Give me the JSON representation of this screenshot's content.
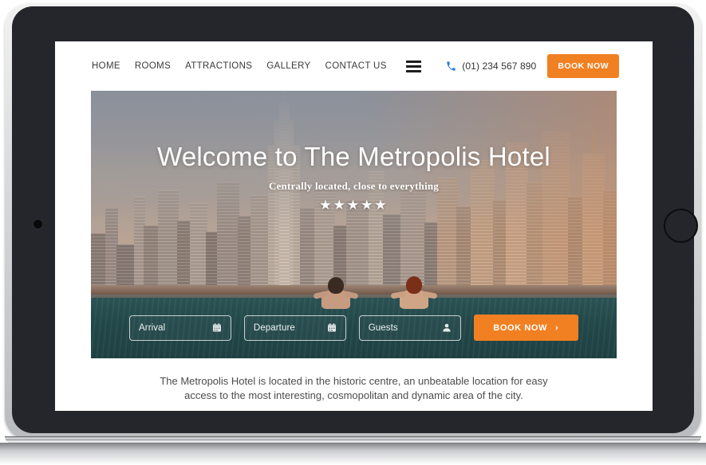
{
  "device": {
    "type": "tablet-landscape",
    "frame_color": "#24262b",
    "bezel_color": "#d6d7d9"
  },
  "header": {
    "nav": [
      {
        "label": "HOME",
        "name": "nav-home"
      },
      {
        "label": "ROOMS",
        "name": "nav-rooms"
      },
      {
        "label": "ATTRACTIONS",
        "name": "nav-attractions"
      },
      {
        "label": "GALLERY",
        "name": "nav-gallery"
      },
      {
        "label": "CONTACT US",
        "name": "nav-contact-us"
      }
    ],
    "menu_icon": "hamburger-icon",
    "phone_icon": "phone-icon",
    "phone_icon_color": "#2e7fd4",
    "phone": "(01) 234 567 890",
    "book_button": "BOOK NOW",
    "book_button_color": "#f08022"
  },
  "hero": {
    "title": "Welcome to The Metropolis Hotel",
    "subtitle": "Centrally located, close to everything",
    "stars": "★★★★★",
    "star_count": 5,
    "image_description": "city-skyline-rooftop-pool"
  },
  "booking": {
    "arrival": {
      "placeholder": "Arrival",
      "icon": "calendar-icon"
    },
    "departure": {
      "placeholder": "Departure",
      "icon": "calendar-icon"
    },
    "guests": {
      "placeholder": "Guests",
      "icon": "person-icon"
    },
    "cta_label": "BOOK NOW",
    "cta_chevron": "›",
    "cta_color": "#f08021"
  },
  "intro": {
    "line1": "The Metropolis Hotel is located in the historic centre, an unbeatable location for easy",
    "line2": "access to the most interesting, cosmopolitan and dynamic area of the city."
  }
}
